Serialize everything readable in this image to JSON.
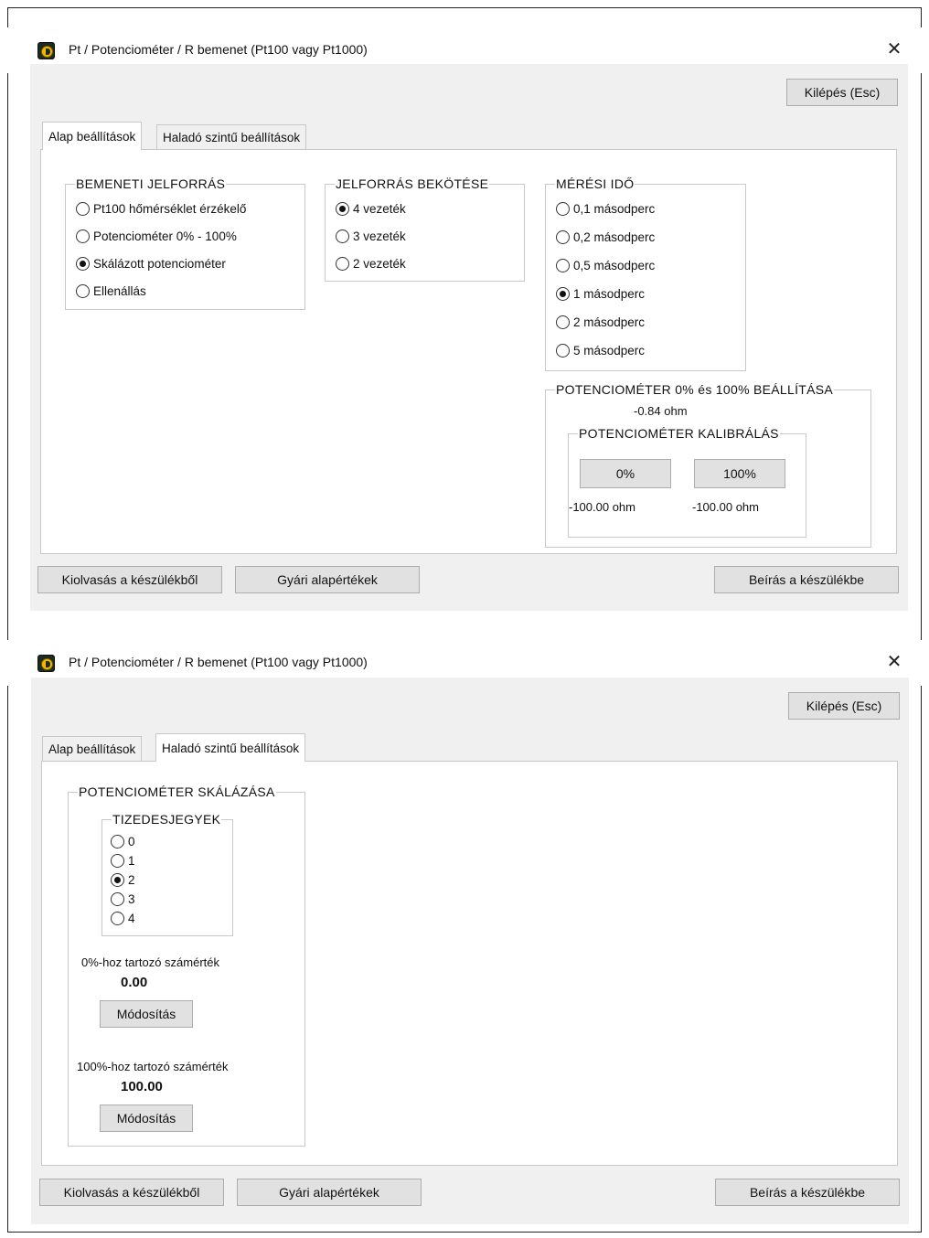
{
  "window_title": "Pt / Potenciométer / R bemenet (Pt100 vagy Pt1000)",
  "close_glyph": "✕",
  "exit_button": "Kilépés (Esc)",
  "tabs": [
    "Alap beállítások",
    "Haladó szintű beállítások"
  ],
  "bottom_buttons": {
    "read": "Kiolvasás a készülékből",
    "defaults": "Gyári alapértékek",
    "write": "Beírás a készülékbe"
  },
  "basic": {
    "input_source": {
      "title": "BEMENETI JELFORRÁS",
      "options": [
        "Pt100 hőmérséklet érzékelő",
        "Potenciométer 0% - 100%",
        "Skálázott potenciométer",
        "Ellenállás"
      ],
      "selected": 2
    },
    "wiring": {
      "title": "JELFORRÁS BEKÖTÉSE",
      "options": [
        "4 vezeték",
        "3 vezeték",
        "2 vezeték"
      ],
      "selected": 0
    },
    "measure_time": {
      "title": "MÉRÉSI IDŐ",
      "options": [
        "0,1 másodperc",
        "0,2 másodperc",
        "0,5 másodperc",
        "1 másodperc",
        "2 másodperc",
        "5 másodperc"
      ],
      "selected": 3
    },
    "pot_setup": {
      "title": "POTENCIOMÉTER 0% és 100% BEÁLLÍTÁSA",
      "reading": "-0.84 ohm",
      "calibration": {
        "title": "POTENCIOMÉTER KALIBRÁLÁS",
        "btn_0": "0%",
        "btn_100": "100%",
        "val_0": "-100.00 ohm",
        "val_100": "-100.00 ohm"
      }
    }
  },
  "advanced": {
    "scaling": {
      "title": "POTENCIOMÉTER SKÁLÁZÁSA",
      "decimals": {
        "title": "TIZEDESJEGYEK",
        "options": [
          "0",
          "1",
          "2",
          "3",
          "4"
        ],
        "selected": 2
      },
      "zero_label": "0%-hoz tartozó számérték",
      "zero_value": "0.00",
      "hundred_label": "100%-hoz tartozó számérték",
      "hundred_value": "100.00",
      "modify_button": "Módosítás"
    }
  }
}
